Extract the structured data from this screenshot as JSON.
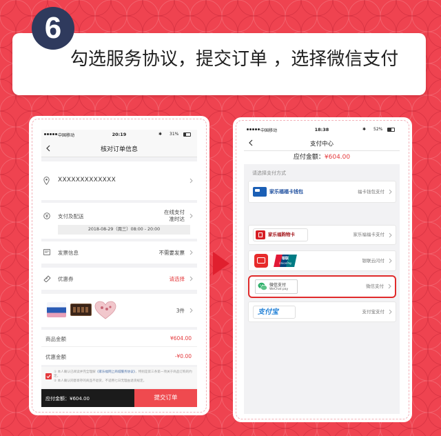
{
  "step": {
    "number": "6"
  },
  "banner": {
    "text": "勾选服务协议，提交订单 ，选择微信支付"
  },
  "colors": {
    "background": "#ef4350",
    "badge": "#2f3a5d",
    "accent_red": "#e4393c",
    "footer_dark": "#1b1b1b",
    "submit_red": "#ef4a4f",
    "highlight_border": "#e02a2a"
  },
  "left_phone": {
    "status_bar": {
      "carrier": "中国移动",
      "time": "20:19",
      "battery": "31%"
    },
    "nav": {
      "title": "核对订单信息",
      "back_icon": "chevron-left-icon"
    },
    "address": {
      "text": "XXXXXXXXXXXXX",
      "icon": "location-pin-icon"
    },
    "delivery": {
      "label": "支付及配送",
      "pay_method": "在线支付",
      "ship_method": "准时达",
      "time_slot": "2018-08-29（周三）08:00 - 20:00",
      "icon": "yen-circle-icon"
    },
    "invoice": {
      "label": "发票信息",
      "value": "不需要发票",
      "icon": "invoice-icon"
    },
    "coupon": {
      "label": "优惠券",
      "value": "请选择",
      "icon": "coupon-icon"
    },
    "products": {
      "count": "3件",
      "items": [
        "pad-pack-thumbnail",
        "chocolate-box-thumbnail",
        "heart-chocolate-thumbnail"
      ]
    },
    "goods_amount": {
      "label": "商品金额",
      "value": "¥604.00"
    },
    "discount": {
      "label": "优惠金额",
      "value": "-¥0.00"
    },
    "agreement": {
      "checked": true,
      "line1_prefix": "① 本人确认已阅读并完全理解",
      "line1_link": "《家乐福网上商城服务协议》",
      "line1_suffix": "，特别是第三条第一项关于商品订购的约定。",
      "line2": "② 本人确认同意寄存的商品不退货，不适用七日无理由退货规定。"
    },
    "footer": {
      "payable": "应付金额：¥604.00",
      "submit": "提交订单"
    }
  },
  "right_phone": {
    "status_bar": {
      "carrier": "中国移动",
      "time": "18:38",
      "battery": "52%"
    },
    "nav": {
      "title": "支付中心",
      "back_icon": "chevron-left-icon"
    },
    "amount": {
      "label": "应付金额：",
      "value": "¥604.00"
    },
    "section_title": "请选择支付方式",
    "options": [
      {
        "name": "家乐福福卡钱包",
        "action": "福卡钱包支付",
        "icon": "carrefour-card-icon",
        "selected": false
      },
      {
        "name": "家乐福购物卡",
        "action": "家乐福福卡支付",
        "icon": "carrefour-gift-card-icon",
        "selected": false
      },
      {
        "logo_top": "银联",
        "logo_bottom": "UnionPay",
        "action": "银联云闪付",
        "icon": "unionpay-icon",
        "selected": false
      },
      {
        "name": "微信支付",
        "name_en": "WeChat pay",
        "action": "微信支付",
        "icon": "wechat-pay-icon",
        "selected": true
      },
      {
        "name": "支付宝",
        "action": "支付宝支付",
        "icon": "alipay-icon",
        "selected": false
      }
    ]
  }
}
